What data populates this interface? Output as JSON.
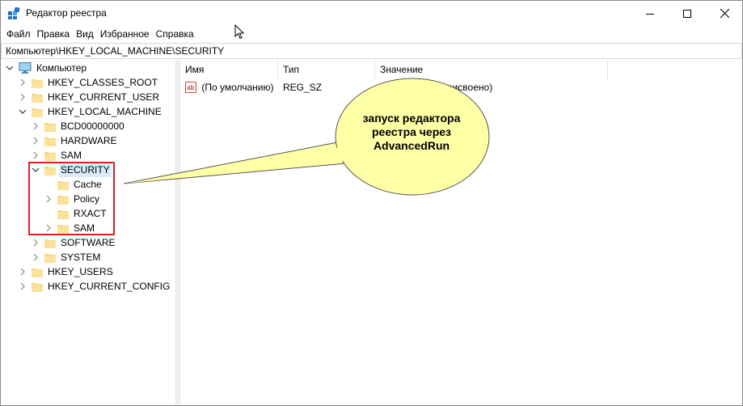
{
  "window": {
    "title": "Редактор реестра",
    "icon": "regedit-icon"
  },
  "menu": [
    "Файл",
    "Правка",
    "Вид",
    "Избранное",
    "Справка"
  ],
  "address": "Компьютер\\HKEY_LOCAL_MACHINE\\SECURITY",
  "tree": {
    "root": "Компьютер",
    "hkcr": "HKEY_CLASSES_ROOT",
    "hkcu": "HKEY_CURRENT_USER",
    "hklm": "HKEY_LOCAL_MACHINE",
    "bcd": "BCD00000000",
    "hardware": "HARDWARE",
    "sam": "SAM",
    "security": "SECURITY",
    "cache": "Cache",
    "policy": "Policy",
    "rxact": "RXACT",
    "sec_sam": "SAM",
    "software": "SOFTWARE",
    "system": "SYSTEM",
    "hku": "HKEY_USERS",
    "hkcc": "HKEY_CURRENT_CONFIG"
  },
  "list": {
    "columns": [
      "Имя",
      "Тип",
      "Значение"
    ],
    "rows": [
      {
        "name": "(По умолчанию)",
        "type": "REG_SZ",
        "value": "(значение не присвоено)"
      }
    ]
  },
  "callout": {
    "line1": "запуск редактора",
    "line2": "реестра через",
    "line3": "AdvancedRun"
  },
  "colors": {
    "highlight_box": "#e02020",
    "callout_fill": "#ffffa6",
    "selection": "#d9ebf9",
    "folder": "#f8d775"
  }
}
